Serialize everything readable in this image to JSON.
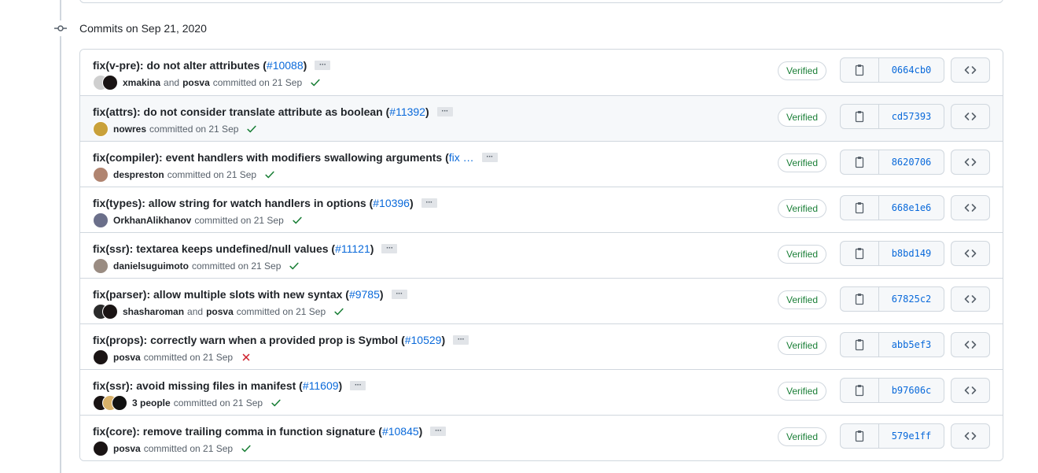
{
  "group": {
    "title": "Commits on Sep 21, 2020"
  },
  "labels": {
    "verified": "Verified",
    "committed": "committed on 21 Sep",
    "and": "and"
  },
  "colors": {
    "link": "#0969da",
    "success": "#1a7f37",
    "danger": "#cf222e",
    "border": "#d0d7de"
  },
  "commits": [
    {
      "title": "fix(v-pre): do not alter attributes (",
      "pr": "#10088",
      "close": ")",
      "authors": [
        "xmakina",
        "posva"
      ],
      "status": "success",
      "sha": "0664cb0",
      "avatar_colors": [
        "#cfcfcf",
        "#1a1414"
      ]
    },
    {
      "title": "fix(attrs): do not consider translate attribute as boolean (",
      "pr": "#11392",
      "close": ")",
      "authors": [
        "nowres"
      ],
      "status": "success",
      "sha": "cd57393",
      "avatar_colors": [
        "#c9a13a"
      ]
    },
    {
      "title": "fix(compiler): event handlers with modifiers swallowing arguments (",
      "pr": "fix …",
      "close": "",
      "authors": [
        "despreston"
      ],
      "status": "success",
      "sha": "8620706",
      "avatar_colors": [
        "#b08470"
      ]
    },
    {
      "title": "fix(types): allow string for watch handlers in options (",
      "pr": "#10396",
      "close": ")",
      "authors": [
        "OrkhanAlikhanov"
      ],
      "status": "success",
      "sha": "668e1e6",
      "avatar_colors": [
        "#6b6f8a"
      ]
    },
    {
      "title": "fix(ssr): textarea keeps undefined/null values (",
      "pr": "#11121",
      "close": ")",
      "authors": [
        "danielsuguimoto"
      ],
      "status": "success",
      "sha": "b8bd149",
      "avatar_colors": [
        "#9a8c82"
      ]
    },
    {
      "title": "fix(parser): allow multiple slots with new syntax (",
      "pr": "#9785",
      "close": ")",
      "authors": [
        "shasharoman",
        "posva"
      ],
      "status": "success",
      "sha": "67825c2",
      "avatar_colors": [
        "#2b2b2b",
        "#1a1414"
      ]
    },
    {
      "title": "fix(props): correctly warn when a provided prop is Symbol (",
      "pr": "#10529",
      "close": ")",
      "authors": [
        "posva"
      ],
      "status": "failure",
      "sha": "abb5ef3",
      "avatar_colors": [
        "#1a1414"
      ]
    },
    {
      "title": "fix(ssr): avoid missing files in manifest (",
      "pr": "#11609",
      "close": ")",
      "authors_label": "3 people",
      "authors": [],
      "status": "success",
      "sha": "b97606c",
      "avatar_colors": [
        "#1a1414",
        "#d9b26a",
        "#111111"
      ]
    },
    {
      "title": "fix(core): remove trailing comma in function signature (",
      "pr": "#10845",
      "close": ")",
      "authors": [
        "posva"
      ],
      "status": "success",
      "sha": "579e1ff",
      "avatar_colors": [
        "#1a1414"
      ]
    }
  ],
  "icons": {
    "group": "git-commit-icon",
    "copy": "clipboard-icon",
    "browse": "code-icon",
    "success": "check-icon",
    "failure": "x-icon",
    "more": "ellipsis-icon"
  }
}
